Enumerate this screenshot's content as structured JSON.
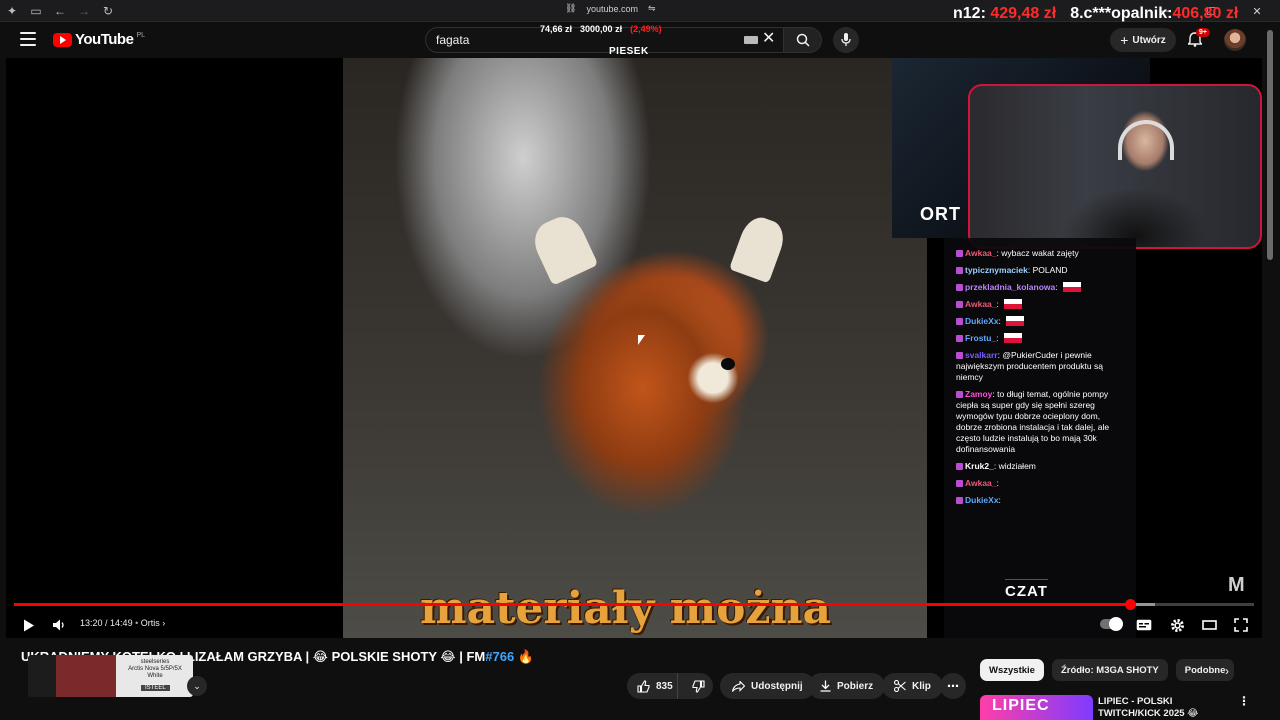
{
  "browser": {
    "url": "youtube.com"
  },
  "ticker": {
    "item1_label": "n12:",
    "item1_amount": "429,48 zł",
    "item2_label": "8.c***opalnik:",
    "item2_amount": "406,80 zł"
  },
  "donation": {
    "current": "74,66 zł",
    "goal": "3000,00 zł",
    "percent": "(2,49%)",
    "label": "PIESEK"
  },
  "header": {
    "logo_text": "YouTube",
    "region": "PL",
    "search_value": "fagata",
    "create_label": "Utwórz",
    "notifications_badge": "9+"
  },
  "player": {
    "subtitle": "materiały można",
    "cam_logo": "ORT",
    "current_time": "13:20",
    "duration": "14:49",
    "time_sep": " / ",
    "chapter": "Ortis",
    "progress_fraction": 0.9,
    "overlay_label": "CZAT",
    "watermark": "M"
  },
  "chat": [
    {
      "user": "Awkaa_",
      "color": "#e85a7a",
      "text": "wybacz wakat zajęty",
      "flag": false
    },
    {
      "user": "typicznymaciek",
      "color": "#9ad0ff",
      "text": "POLAND",
      "flag": false
    },
    {
      "user": "przekladnia_kolanowa",
      "color": "#b982ff",
      "text": "",
      "flag": true
    },
    {
      "user": "Awkaa_",
      "color": "#e85a7a",
      "text": "",
      "flag": true
    },
    {
      "user": "DukieXx",
      "color": "#5fa8ff",
      "text": "",
      "flag": true
    },
    {
      "user": "Frostu_",
      "color": "#5fa8ff",
      "text": "",
      "flag": true
    },
    {
      "user": "svalkarr",
      "color": "#7a5cff",
      "text": "@PukierCuder i pewnie największym producentem produktu są niemcy",
      "flag": false
    },
    {
      "user": "Zamoy",
      "color": "#ff4fd8",
      "text": "to długi temat, ogólnie pompy ciepła są super gdy się spełni szereg wymogów typu dobrze ocieplony dom, dobrze zrobiona instalacja i tak dalej, ale często ludzie instalują to bo mają 30k dofinansowania",
      "flag": false
    },
    {
      "user": "Kruk2_",
      "color": "#ffffff",
      "text": "widziałem",
      "flag": false
    },
    {
      "user": "Awkaa_",
      "color": "#e85a7a",
      "text": "",
      "flag": false
    },
    {
      "user": "DukieXx",
      "color": "#5fa8ff",
      "text": "",
      "flag": false
    }
  ],
  "video": {
    "title_main": "UKRADNIEMY KOTEŁKO I LIZAŁAM GRZYBA | 😂 POLSKIE SHOTY 😂 | FM",
    "title_tag": "#766",
    "title_end": " 🔥"
  },
  "sponsor": {
    "brand_small": "steelseries",
    "product": "Arctis Nova 5/5P/5X White",
    "brand": "ISTEEL"
  },
  "actions": {
    "likes": "835",
    "share": "Udostępnij",
    "download": "Pobierz",
    "clip": "Klip"
  },
  "chips": [
    "Wszystkie",
    "Źródło: M3GA SHOTY",
    "Podobne"
  ],
  "recommendation": {
    "thumb_text": "LIPIEC",
    "title": "LIPIEC - POLSKI TWITCH/KICK 2025 😂"
  },
  "colors": {
    "accent": "#ff0000",
    "chip_active": "#f1f1f1",
    "link": "#3ea6ff"
  }
}
